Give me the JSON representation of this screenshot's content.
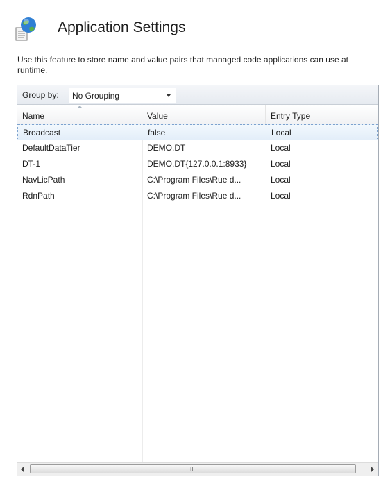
{
  "header": {
    "title": "Application Settings",
    "icon": "app-settings-globe-icon",
    "description": "Use this feature to store name and value pairs that managed code applications can use at runtime."
  },
  "group_bar": {
    "label": "Group by:",
    "selected": "No Grouping"
  },
  "table": {
    "columns": [
      "Name",
      "Value",
      "Entry Type"
    ],
    "sort_column": "Name",
    "rows": [
      {
        "name": "Broadcast",
        "value": "false",
        "type": "Local",
        "selected": true
      },
      {
        "name": "DefaultDataTier",
        "value": "DEMO.DT",
        "type": "Local"
      },
      {
        "name": "DT-1",
        "value": "DEMO.DT{127.0.0.1:8933}",
        "type": "Local"
      },
      {
        "name": "NavLicPath",
        "value": "C:\\Program Files\\Rue d...",
        "type": "Local"
      },
      {
        "name": "RdnPath",
        "value": "C:\\Program Files\\Rue d...",
        "type": "Local"
      }
    ]
  },
  "scrollbar": {
    "grip": "III"
  },
  "colors": {
    "border": "#a5acb5",
    "selection_border": "#7da2ce",
    "selection_fill": "#e3eef9"
  }
}
